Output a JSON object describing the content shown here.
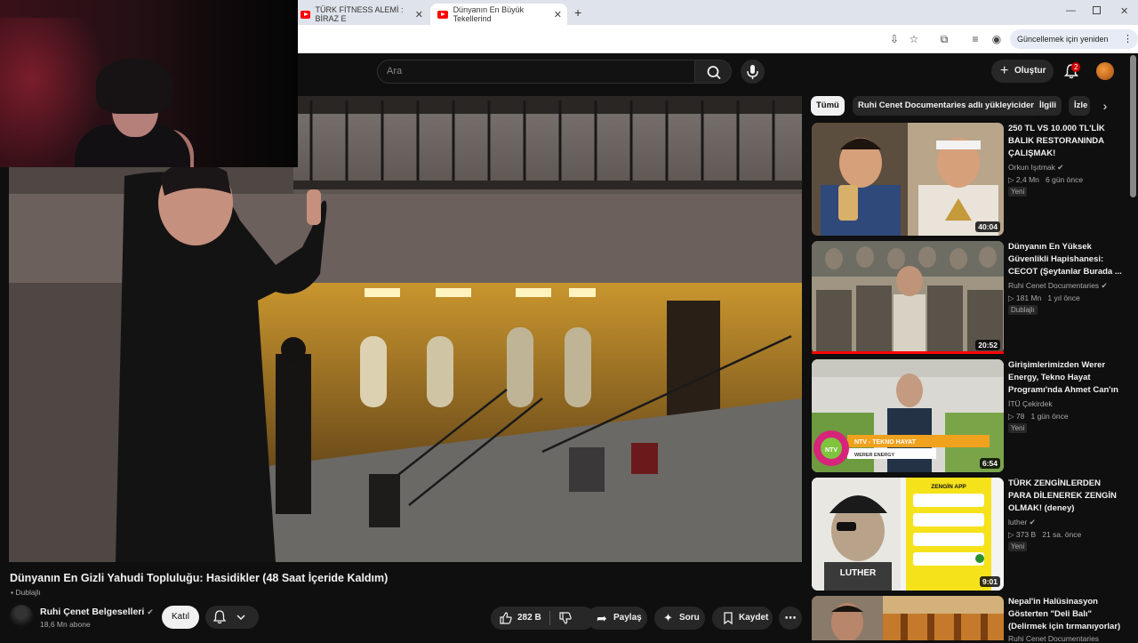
{
  "browser": {
    "tabs": [
      {
        "title": "TÜRK FİTNESS ALEMİ : BİRAZ E"
      },
      {
        "title": "Dünyanın En Büyük Tekellerind"
      }
    ],
    "update_button": "Güncellemek için yeniden başlat"
  },
  "header": {
    "search_placeholder": "Ara",
    "create_label": "Oluştur",
    "notification_count": "2"
  },
  "video": {
    "title": "Dünyanın En Gizli Yahudi Topluluğu: Hasidikler (48 Saat İçeride Kaldım)",
    "dub_label": "Dublajlı",
    "channel_name": "Ruhi Çenet Belgeselleri",
    "subscribers": "18,6 Mn abone",
    "join_label": "Katıl",
    "likes": "282 B",
    "share_label": "Paylaş",
    "ask_label": "Soru",
    "save_label": "Kaydet"
  },
  "sidebar": {
    "chips": [
      "Tümü",
      "Ruhi Cenet Documentaries adlı yükleyiciden",
      "İlgili",
      "İzle"
    ],
    "recommendations": [
      {
        "title": "250 TL VS 10.000 TL'LİK BALIK RESTORANINDA ÇALIŞMAK!",
        "channel": "Orkun Işıtmak",
        "views": "2,4 Mn",
        "age": "6 gün önce",
        "badge": "Yeni",
        "duration": "40:04"
      },
      {
        "title": "Dünyanın En Yüksek Güvenlikli Hapishanesi: CECOT (Şeytanlar Burada ...",
        "channel": "Ruhi Cenet Documentaries",
        "views": "181 Mn",
        "age": "1 yıl önce",
        "badge": "Dublajlı",
        "duration": "20:52"
      },
      {
        "title": "Girişimlerimizden Werer Energy, Tekno Hayat Programı'nda Ahmet Can'ın ...",
        "channel": "İTÜ Çekirdek",
        "views": "78",
        "age": "1 gün önce",
        "badge": "Yeni",
        "duration": "6:54"
      },
      {
        "title": "TÜRK ZENGİNLERDEN PARA DİLENEREK ZENGİN OLMAK! (deney)",
        "channel": "luther",
        "views": "373 B",
        "age": "21 sa. önce",
        "badge": "Yeni",
        "duration": "9:01"
      },
      {
        "title": "Nepal'in Halüsinasyon Gösterten \"Deli Balı\" (Delirmek için tırmanıyorlar)",
        "channel": "Ruhi Cenet Documentaries",
        "views": "",
        "age": "",
        "badge": "",
        "duration": ""
      }
    ]
  },
  "thumb_text": {
    "ntv_logo": "NTV",
    "ntv_banner": "NTV - TEKNO HAYAT",
    "ntv_sub": "WERER ENERGY",
    "zengin_title": "ZENGİN APP",
    "luther_text": "LUTHER"
  }
}
